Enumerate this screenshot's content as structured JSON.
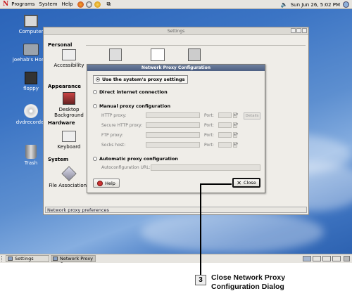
{
  "top_panel": {
    "logo": "N",
    "menus": [
      "Programs",
      "System",
      "Help"
    ],
    "datetime": "Sun Jun 26,  5:02 PM"
  },
  "desktop_icons": [
    {
      "label": "Computer",
      "icon": "computer-icon"
    },
    {
      "label": "joehab's Home",
      "icon": "home-folder-icon"
    },
    {
      "label": "floppy",
      "icon": "floppy-icon"
    },
    {
      "label": "dvdrecorder",
      "icon": "dvd-icon"
    },
    {
      "label": "Trash",
      "icon": "trash-icon"
    }
  ],
  "settings": {
    "title": "Settings",
    "categories": [
      "Personal",
      "Appearance",
      "Hardware",
      "System"
    ],
    "items": {
      "accessibility": "Accessibility",
      "desktop_background": "Desktop Background",
      "keyboard": "Keyboard",
      "file_associations": "File Associations"
    },
    "status": "Network proxy preferences"
  },
  "dialog": {
    "title": "Network Proxy Configuration",
    "options": {
      "system": "Use the system's proxy settings",
      "direct": "Direct internet connection",
      "manual": "Manual proxy configuration",
      "auto": "Automatic proxy configuration"
    },
    "selected": "system",
    "fields": {
      "http": "HTTP proxy:",
      "secure_http": "Secure HTTP proxy:",
      "ftp": "FTP proxy:",
      "socks": "Socks host:",
      "port": "Port:",
      "details": "Details",
      "autoconfig_url": "Autoconfiguration URL:"
    },
    "help_label": "Help",
    "close_label": "Close"
  },
  "taskbar": {
    "tasks": [
      "Settings",
      "Network Proxy Co"
    ]
  },
  "callout": {
    "number": "3",
    "text": "Close Network Proxy Configuration Dialog"
  }
}
